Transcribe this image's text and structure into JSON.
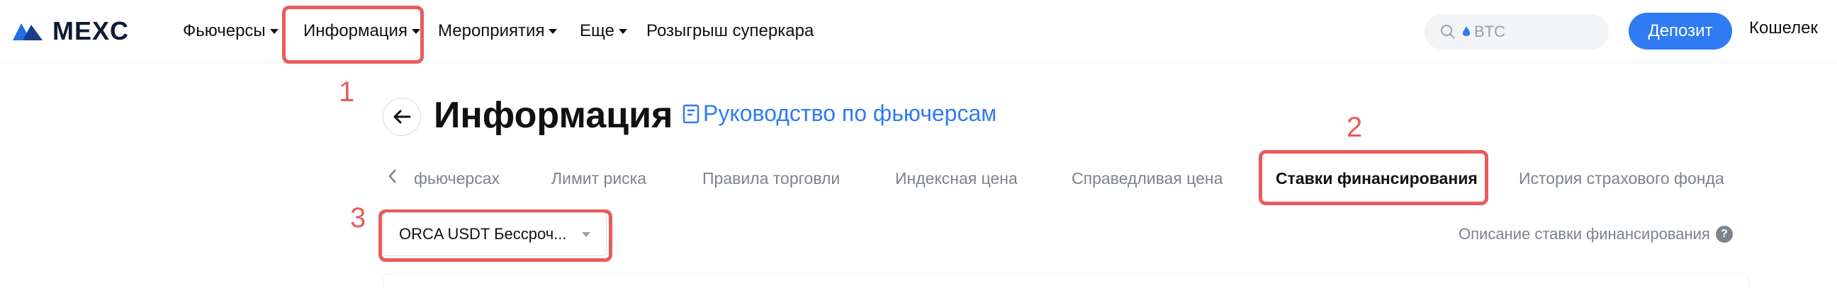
{
  "header": {
    "logo_text": "MEXC",
    "nav": [
      {
        "label": "Фьючерсы",
        "has_caret": true
      },
      {
        "label": "Информация",
        "has_caret": true
      },
      {
        "label": "Мероприятия",
        "has_caret": true
      },
      {
        "label": "Еще",
        "has_caret": true
      },
      {
        "label": "Розыгрыш суперкара",
        "has_caret": false
      }
    ],
    "search_placeholder": "BTC",
    "deposit_label": "Депозит",
    "wallet_label": "Кошелек"
  },
  "page": {
    "title": "Информация",
    "guide_link": "Руководство по фьючерсам"
  },
  "tabs": [
    {
      "label": "фьючерсах",
      "active": false
    },
    {
      "label": "Лимит риска",
      "active": false
    },
    {
      "label": "Правила торговли",
      "active": false
    },
    {
      "label": "Индексная цена",
      "active": false
    },
    {
      "label": "Справедливая цена",
      "active": false
    },
    {
      "label": "Ставки финансирования",
      "active": true
    },
    {
      "label": "История страхового фонда",
      "active": false
    }
  ],
  "contract_select": {
    "value": "ORCA USDT Бессроч..."
  },
  "funding_rate_description": "Описание ставки финансирования",
  "annotations": [
    "1",
    "2",
    "3"
  ],
  "colors": {
    "accent": "#2f7bf2",
    "annotation": "#e85c5c",
    "muted_text": "#7d838c"
  }
}
